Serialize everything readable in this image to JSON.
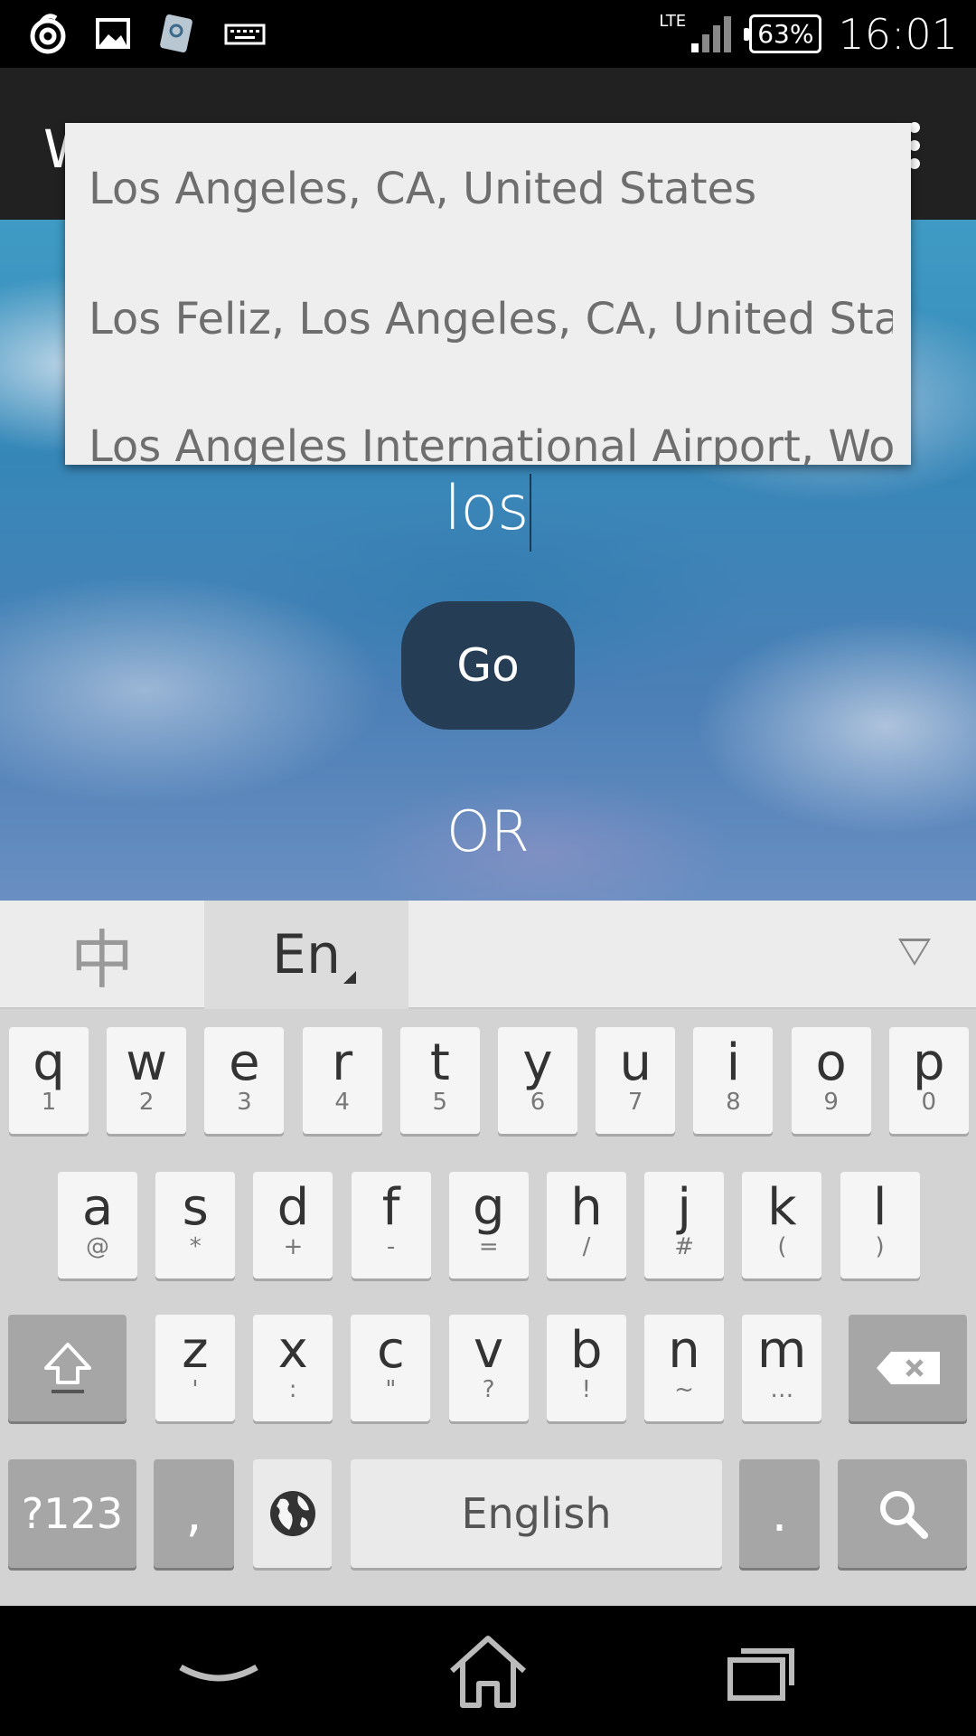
{
  "status_bar": {
    "network": "LTE",
    "battery": "63%",
    "time": "16:01",
    "icons": [
      "sync-icon",
      "gallery-icon",
      "app-icon",
      "keyboard-icon"
    ]
  },
  "action_bar": {
    "title_peek": "W"
  },
  "search": {
    "input_value": "los",
    "go_label": "Go",
    "or_label": "OR"
  },
  "suggestions": [
    "Los Angeles, CA, United States",
    "Los Feliz, Los Angeles, CA, United States",
    "Los Angeles International Airport, World Way, Los Angeles, CA, United States"
  ],
  "keyboard": {
    "lang_cn": "中",
    "lang_en": "En",
    "row1": [
      {
        "k": "q",
        "s": "1"
      },
      {
        "k": "w",
        "s": "2"
      },
      {
        "k": "e",
        "s": "3"
      },
      {
        "k": "r",
        "s": "4"
      },
      {
        "k": "t",
        "s": "5"
      },
      {
        "k": "y",
        "s": "6"
      },
      {
        "k": "u",
        "s": "7"
      },
      {
        "k": "i",
        "s": "8"
      },
      {
        "k": "o",
        "s": "9"
      },
      {
        "k": "p",
        "s": "0"
      }
    ],
    "row2": [
      {
        "k": "a",
        "s": "@"
      },
      {
        "k": "s",
        "s": "*"
      },
      {
        "k": "d",
        "s": "+"
      },
      {
        "k": "f",
        "s": "-"
      },
      {
        "k": "g",
        "s": "="
      },
      {
        "k": "h",
        "s": "/"
      },
      {
        "k": "j",
        "s": "#"
      },
      {
        "k": "k",
        "s": "("
      },
      {
        "k": "l",
        "s": ")"
      }
    ],
    "row3": [
      {
        "k": "z",
        "s": "'"
      },
      {
        "k": "x",
        "s": ":"
      },
      {
        "k": "c",
        "s": "\""
      },
      {
        "k": "v",
        "s": "?"
      },
      {
        "k": "b",
        "s": "!"
      },
      {
        "k": "n",
        "s": "~"
      },
      {
        "k": "m",
        "s": "…"
      }
    ],
    "symbols_label": "?123",
    "comma_label": ",",
    "space_label": "English",
    "period_label": "."
  },
  "colors": {
    "go_button": "#263d56",
    "dropdown_bg": "#eeeeee",
    "suggestion_text": "#6e6e6e"
  }
}
